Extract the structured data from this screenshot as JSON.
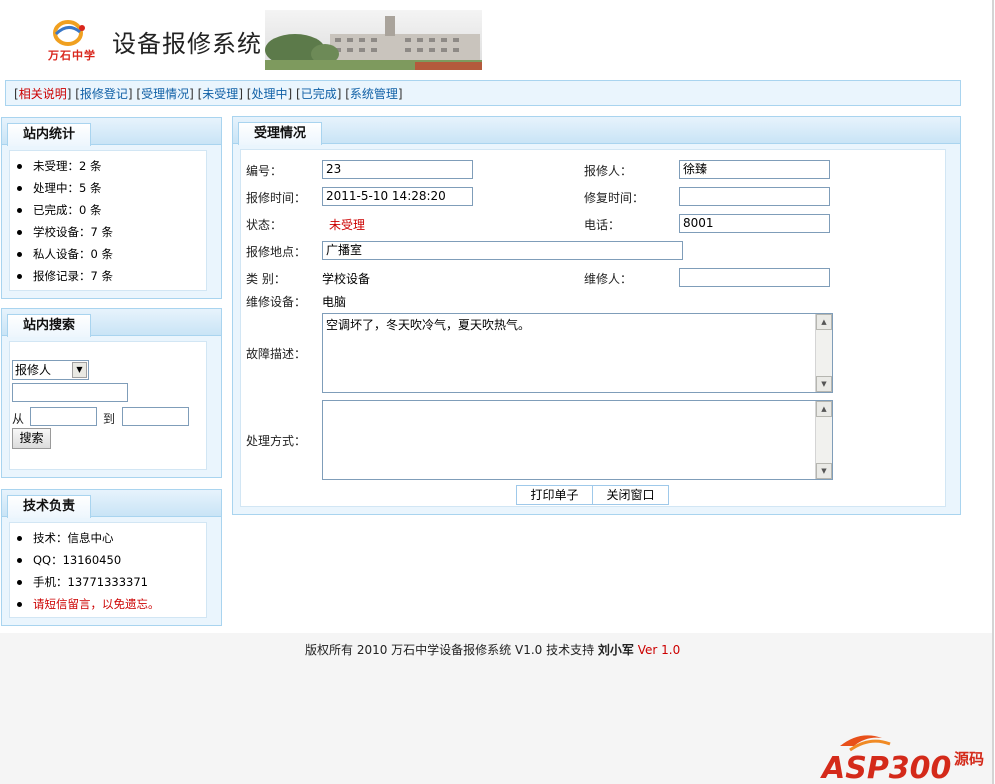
{
  "header": {
    "logo_text": "万石中学",
    "title": "设备报修系统"
  },
  "nav": {
    "items": [
      {
        "label": "相关说明"
      },
      {
        "label": "报修登记"
      },
      {
        "label": "受理情况"
      },
      {
        "label": "未受理"
      },
      {
        "label": "处理中"
      },
      {
        "label": "已完成"
      },
      {
        "label": "系统管理"
      }
    ]
  },
  "stats": {
    "title": "站内统计",
    "items": [
      {
        "label": "未受理：",
        "value": "2 条"
      },
      {
        "label": "处理中：",
        "value": "5 条"
      },
      {
        "label": "已完成：",
        "value": "0 条"
      },
      {
        "label": "学校设备：",
        "value": "7 条"
      },
      {
        "label": "私人设备：",
        "value": "0 条"
      },
      {
        "label": "报修记录：",
        "value": "7 条"
      }
    ]
  },
  "search": {
    "title": "站内搜索",
    "field_selected": "报修人",
    "keyword": "",
    "from_label": "从",
    "to_label": "到",
    "button": "搜索"
  },
  "tech": {
    "title": "技术负责",
    "items": [
      {
        "text": "技术：信息中心"
      },
      {
        "text": "QQ：13160450"
      },
      {
        "text": "手机：13771333371"
      },
      {
        "text": "请短信留言，以免遗忘。"
      }
    ]
  },
  "detail": {
    "title": "受理情况",
    "id_label": "编号：",
    "id_value": "23",
    "reporter_label": "报修人：",
    "reporter_value": "徐臻",
    "report_time_label": "报修时间：",
    "report_time_value": "2011-5-10 14:28:20",
    "repair_time_label": "修复时间：",
    "repair_time_value": "",
    "status_label": "状态：",
    "status_value": "未受理",
    "phone_label": "电话：",
    "phone_value": "8001",
    "location_label": "报修地点：",
    "location_value": "广播室",
    "category_label": "类 别：",
    "category_value": "学校设备",
    "repairer_label": "维修人：",
    "repairer_value": "",
    "device_label": "维修设备：",
    "device_value": "电脑",
    "fault_label": "故障描述：",
    "fault_value": "空调坏了，冬天吹冷气，夏天吹热气。",
    "method_label": "处理方式：",
    "method_value": "",
    "print_button": "打印单子",
    "close_button": "关闭窗口"
  },
  "footer": {
    "prefix": "版权所有 2010 万石中学设备报修系统 V1.0 技术支持",
    "author": "刘小军",
    "version": "Ver 1.0"
  },
  "watermark": {
    "brand": "ASP300",
    "suffix": "源码"
  },
  "colors": {
    "panel_bg": "#eaf5fd",
    "panel_border": "#a9d4ef",
    "link": "#1060a6",
    "alert": "#cc0000"
  }
}
